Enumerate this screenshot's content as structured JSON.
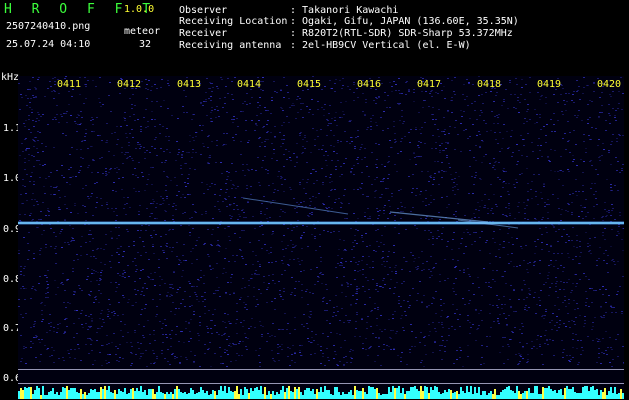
{
  "app": {
    "name": "H R O F F T",
    "version": "1.0.0"
  },
  "file": {
    "name": "2507240410.png",
    "datetime": "25.07.24 04:10"
  },
  "detection": {
    "label": "meteor",
    "count": "32"
  },
  "info": [
    {
      "label": "Observer",
      "value": ": Takanori Kawachi"
    },
    {
      "label": "Receiving Location",
      "value": ": Ogaki, Gifu, JAPAN (136.60E, 35.35N)"
    },
    {
      "label": "Receiver",
      "value": ": R820T2(RTL-SDR) SDR-Sharp 53.372MHz"
    },
    {
      "label": "Receiving antenna",
      "value": ": 2el-HB9CV Vertical (el. E-W)"
    }
  ],
  "axis": {
    "unit": "kHz",
    "y_ticks": [
      "1.1",
      "1.0",
      "0.9",
      "0.8",
      "0.7",
      "0.6"
    ],
    "time_ticks": [
      "0411",
      "0412",
      "0413",
      "0414",
      "0415",
      "0416",
      "0417",
      "0418",
      "0419",
      "0420"
    ]
  },
  "colors": {
    "background": "#000000",
    "label_green": "#3cff3c",
    "version_yellow": "#ffff33",
    "noise_blue": "#1a1a8c",
    "carrier": "#7fd8ff"
  }
}
